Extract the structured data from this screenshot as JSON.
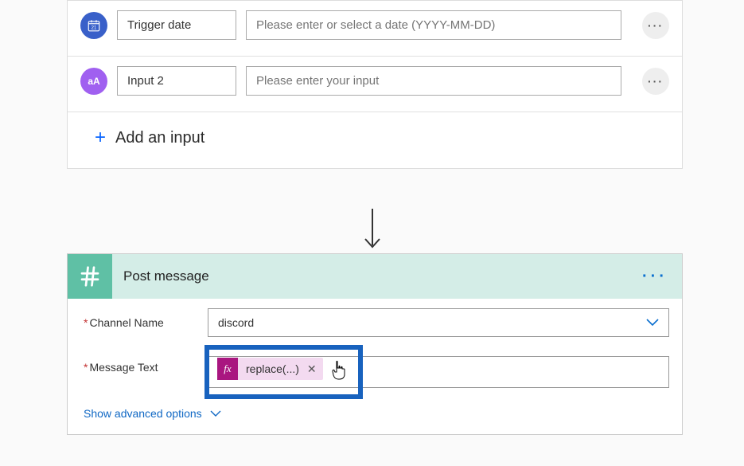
{
  "trigger": {
    "inputs": [
      {
        "badge_type": "calendar",
        "name": "Trigger date",
        "placeholder": "Please enter or select a date (YYYY-MM-DD)"
      },
      {
        "badge_type": "text",
        "badge_label": "aA",
        "name": "Input 2",
        "placeholder": "Please enter your input"
      }
    ],
    "add_input_label": "Add an input"
  },
  "action": {
    "title": "Post message",
    "fields": {
      "channel_label": "Channel Name",
      "channel_value": "discord",
      "message_label": "Message Text",
      "token_text": "replace(...)"
    },
    "advanced_label": "Show advanced options",
    "fx_label": "fx"
  },
  "more_dots": "···"
}
